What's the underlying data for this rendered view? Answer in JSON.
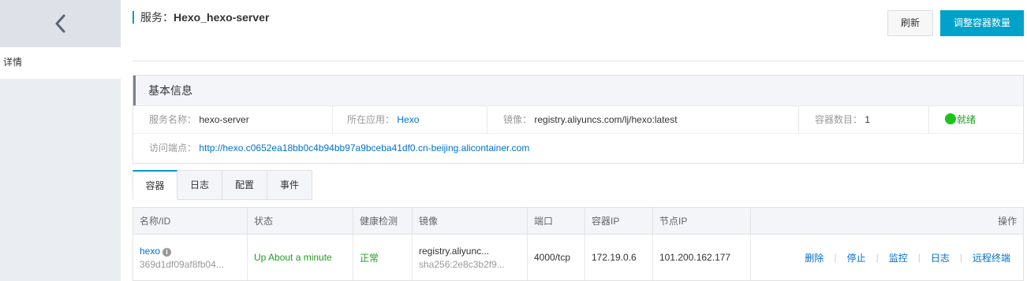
{
  "sidebar": {
    "back_label": "",
    "nav_item": "详情"
  },
  "header": {
    "prefix": "服务：",
    "service_name": "Hexo_hexo-server"
  },
  "toolbar": {
    "refresh_label": "刷新",
    "scale_label": "调整容器数量"
  },
  "basic_info": {
    "title": "基本信息",
    "service_name_label": "服务名称：",
    "service_name_value": "hexo-server",
    "app_label": "所在应用：",
    "app_value": "Hexo",
    "image_label": "镜像：",
    "image_value": "registry.aliyuncs.com/lj/hexo:latest",
    "container_count_label": "容器数目：",
    "container_count_value": "1",
    "status_value": "就绪",
    "endpoint_label": "访问端点：",
    "endpoint_value": "http://hexo.c0652ea18bb0c4b94bb97a9bceba41df0.cn-beijing.alicontainer.com"
  },
  "tabs": [
    "容器",
    "日志",
    "配置",
    "事件"
  ],
  "table": {
    "columns": [
      "名称/ID",
      "状态",
      "健康检测",
      "镜像",
      "端口",
      "容器IP",
      "节点IP",
      "操作"
    ],
    "rows": [
      {
        "name": "hexo",
        "id": "369d1df09af8fb04...",
        "status": "Up About a minute",
        "health": "正常",
        "image": "registry.aliyunc...",
        "image_sha": "sha256:2e8c3b2f9...",
        "port": "4000/tcp",
        "container_ip": "172.19.0.6",
        "node_ip": "101.200.162.177",
        "actions": [
          "删除",
          "停止",
          "监控",
          "日志",
          "远程终端"
        ]
      }
    ]
  },
  "colors": {
    "accent": "#00a2ca",
    "link": "#0070cc",
    "success": "#1bc31b"
  }
}
